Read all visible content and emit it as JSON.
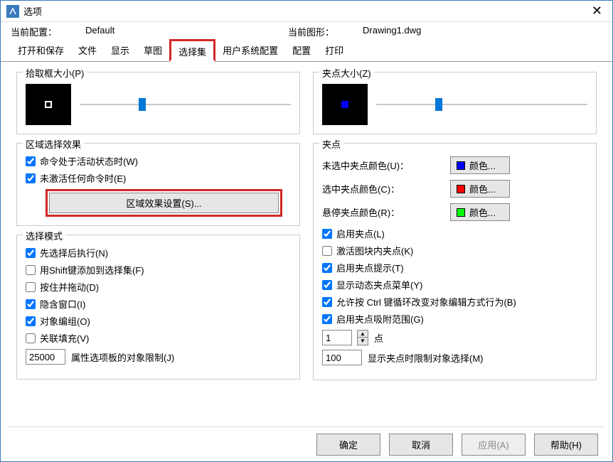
{
  "window": {
    "title": "选项",
    "close": "✕"
  },
  "info": {
    "cfgLabel": "当前配置：",
    "cfgValue": "Default",
    "dwgLabel": "当前图形：",
    "dwgValue": "Drawing1.dwg"
  },
  "tabs": {
    "open": "打开和保存",
    "file": "文件",
    "display": "显示",
    "sketch": "草图",
    "select": "选择集",
    "user": "用户系统配置",
    "config": "配置",
    "print": "打印"
  },
  "pickbox": {
    "title": "拾取框大小(P)"
  },
  "area": {
    "title": "区域选择效果",
    "activeCmd": "命令处于活动状态时(W)",
    "noCmd": "未激活任何命令时(E)",
    "settingsBtn": "区域效果设置(S)..."
  },
  "mode": {
    "title": "选择模式",
    "preSelect": "先选择后执行(N)",
    "shiftAdd": "用Shift键添加到选择集(F)",
    "pressDrag": "按住并拖动(D)",
    "implied": "隐含窗口(I)",
    "group": "对象编组(O)",
    "hatch": "关联填充(V)",
    "limitValue": "25000",
    "limitLabel": "属性选项板的对象限制(J)"
  },
  "gripsize": {
    "title": "夹点大小(Z)"
  },
  "grips": {
    "title": "夹点",
    "unselColor": "未选中夹点颜色(U)：",
    "selColor": "选中夹点颜色(C)：",
    "hoverColor": "悬停夹点颜色(R)：",
    "colorBtn": "颜色...",
    "enable": "启用夹点(L)",
    "block": "激活图块内夹点(K)",
    "tips": "启用夹点提示(T)",
    "dynmenu": "显示动态夹点菜单(Y)",
    "ctrlCycle": "允许按 Ctrl 键循环改变对象编辑方式行为(B)",
    "snap": "启用夹点吸附范围(G)",
    "snapVal": "1",
    "snapUnit": "点",
    "limitVal": "100",
    "limitLabel": "显示夹点时限制对象选择(M)"
  },
  "footer": {
    "ok": "确定",
    "cancel": "取消",
    "apply": "应用(A)",
    "help": "帮助(H)"
  }
}
